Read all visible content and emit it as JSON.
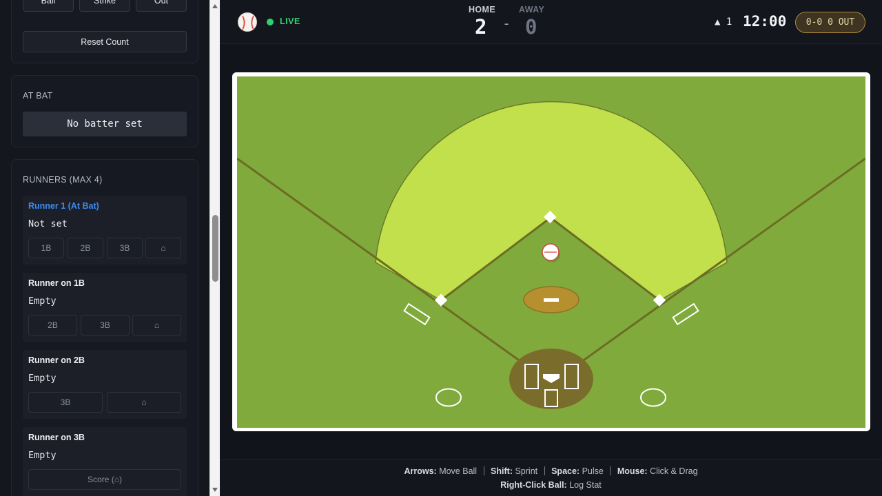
{
  "count_controls": {
    "ball_label": "Ball",
    "strike_label": "Strike",
    "out_label": "Out",
    "reset_label": "Reset Count"
  },
  "at_bat": {
    "title": "AT BAT",
    "batter": "No batter set"
  },
  "runners": {
    "title": "RUNNERS (MAX 4)",
    "items": [
      {
        "title": "Runner 1 (At Bat)",
        "status": "Not set",
        "actions": [
          "1B",
          "2B",
          "3B",
          "⌂"
        ],
        "active": true
      },
      {
        "title": "Runner on 1B",
        "status": "Empty",
        "actions": [
          "2B",
          "3B",
          "⌂"
        ]
      },
      {
        "title": "Runner on 2B",
        "status": "Empty",
        "actions": [
          "3B",
          "⌂"
        ]
      },
      {
        "title": "Runner on 3B",
        "status": "Empty",
        "actions": [
          "Score (⌂)"
        ]
      }
    ]
  },
  "scoreboard": {
    "live_label": "LIVE",
    "home_label": "HOME",
    "home_score": "2",
    "score_separator": "-",
    "away_label": "AWAY",
    "away_score": "0",
    "inning": "▲ 1",
    "clock": "12:00",
    "count": "0-0 0 OUT"
  },
  "footer": {
    "shortcuts": [
      {
        "key": "Arrows:",
        "action": "Move Ball"
      },
      {
        "key": "Shift:",
        "action": "Sprint"
      },
      {
        "key": "Space:",
        "action": "Pulse"
      },
      {
        "key": "Mouse:",
        "action": "Click & Drag"
      }
    ],
    "secondary": {
      "key": "Right-Click Ball:",
      "action": "Log Stat"
    }
  },
  "colors": {
    "grass": "#80ab3c",
    "infield_arc": "#c2e04b",
    "dirt": "#b6902e",
    "home_dirt": "#7a6d2c",
    "foul_line": "#6c6c25",
    "live_green": "#2fd071",
    "accent_blue": "#3d8bf0",
    "badge_gold": "#b08a38"
  }
}
